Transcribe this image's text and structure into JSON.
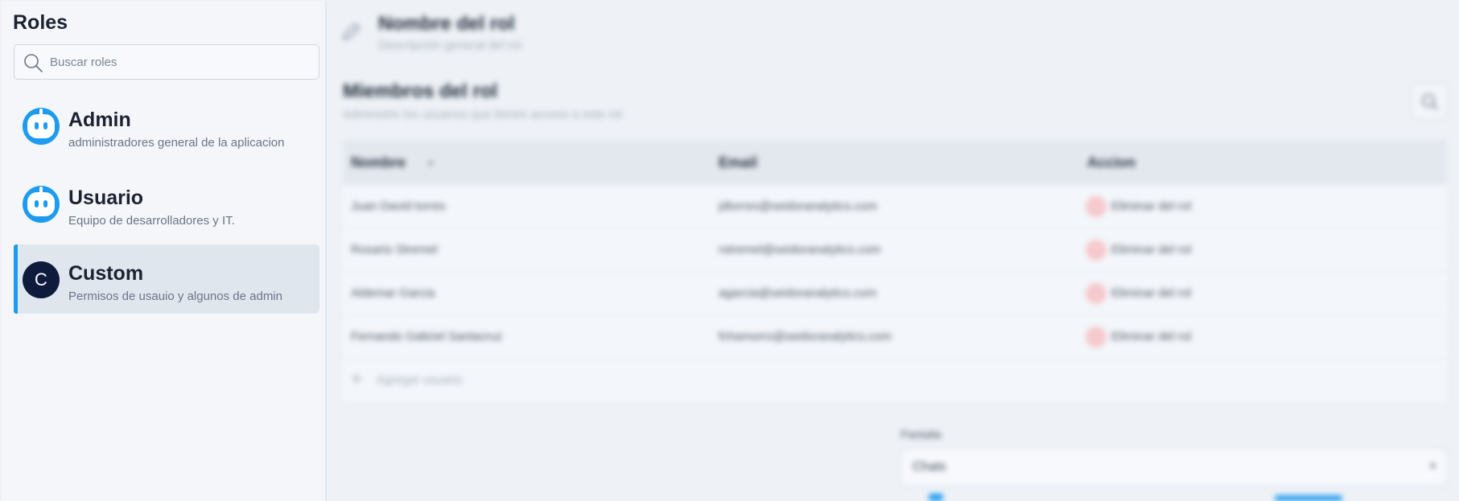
{
  "sidebar": {
    "title": "Roles",
    "search_placeholder": "Buscar roles",
    "roles": [
      {
        "name": "Admin",
        "description": "administradores general de la aplicacion",
        "avatar": "bot-icon"
      },
      {
        "name": "Usuario",
        "description": "Equipo de desarrolladores y IT.",
        "avatar": "bot-icon"
      },
      {
        "name": "Custom",
        "description": "Permisos de usauio y algunos de admin",
        "avatar_letter": "C",
        "selected": true
      }
    ]
  },
  "main": {
    "role_title": "Nombre del rol",
    "role_subtitle": "Descripción general del rol",
    "members_title": "Miembros del rol",
    "members_subtitle": "Administre los usuarios que tienen acceso a este rol",
    "table": {
      "headers": {
        "name": "Nombre",
        "email": "Email",
        "action": "Accion"
      },
      "rows": [
        {
          "name": "Juan David torres",
          "email": "jdtorres@seidoranalytics.com",
          "action": "Eliminar del rol"
        },
        {
          "name": "Rosario Stremel",
          "email": "rstremel@seidoranalytics.com",
          "action": "Eliminar del rol"
        },
        {
          "name": "Aldemar Garcia",
          "email": "agarcia@seidoranalytics.com",
          "action": "Eliminar del rol"
        },
        {
          "name": "Fernando Gabriel Santacruz",
          "email": "fchamorro@seidoranalytics.com",
          "action": "Eliminar del rol"
        }
      ],
      "add_label": "Agregar usuario"
    },
    "screen": {
      "label": "Pantalla",
      "value": "Chats"
    }
  },
  "colors": {
    "accent": "#1d9bf0",
    "danger_soft": "#f6c9cc",
    "avatar_dark": "#0f1b3d"
  }
}
